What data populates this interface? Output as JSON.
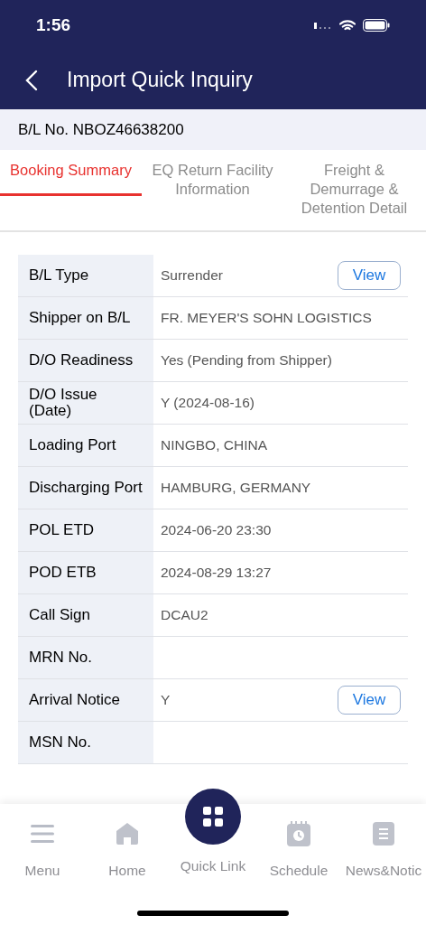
{
  "status_bar": {
    "time": "1:56"
  },
  "header": {
    "title": "Import Quick Inquiry"
  },
  "bl_number": "B/L No. NBOZ46638200",
  "tabs": [
    {
      "label": "Booking Summary",
      "selected": true
    },
    {
      "label": "EQ Return Facility Information",
      "selected": false
    },
    {
      "label": "Freight & Demurrage & Detention Detail",
      "selected": false
    }
  ],
  "rows": [
    {
      "label": "B/L Type",
      "value": "Surrender",
      "button": "View"
    },
    {
      "label": "Shipper on B/L",
      "value": "FR. MEYER'S SOHN LOGISTICS"
    },
    {
      "label": "D/O Readiness",
      "value": "Yes (Pending from Shipper)"
    },
    {
      "label": "D/O Issue (Date)",
      "value": "Y (2024-08-16)"
    },
    {
      "label": "Loading Port",
      "value": "NINGBO, CHINA"
    },
    {
      "label": "Discharging Port",
      "value": "HAMBURG, GERMANY"
    },
    {
      "label": "POL ETD",
      "value": "2024-06-20 23:30"
    },
    {
      "label": "POD ETB",
      "value": "2024-08-29 13:27"
    },
    {
      "label": "Call Sign",
      "value": "DCAU2"
    },
    {
      "label": "MRN No."
    },
    {
      "label": "Arrival Notice",
      "value": "Y",
      "button": "View"
    },
    {
      "label": "MSN No."
    }
  ],
  "bottom_nav": [
    {
      "kind": "menu",
      "label": "Menu"
    },
    {
      "kind": "home",
      "label": "Home"
    },
    {
      "kind": "quick",
      "label": "Quick Link"
    },
    {
      "kind": "schedule",
      "label": "Schedule"
    },
    {
      "kind": "news",
      "label": "News&Notic"
    }
  ]
}
